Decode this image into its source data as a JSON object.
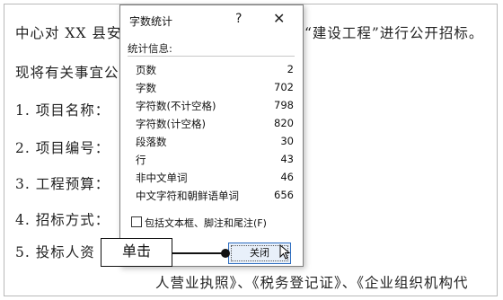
{
  "document": {
    "line1_left": "中心对 XX 县安",
    "line1_right": "“建设工程”进行公开招标。",
    "line2": "现将有关事宜公",
    "line3": "1.  项目名称：",
    "line4": "2.  项目编号：",
    "line5": "3.  工程预算：",
    "line6": "4.  招标方式：",
    "line7": "5.  投标人资",
    "line8": "人营业执照》、《税务登记证》、《企业组织机构代"
  },
  "dialog": {
    "title": "字数统计",
    "help_symbol": "?",
    "close_symbol": "✕",
    "section_label": "统计信息:",
    "stats": [
      {
        "label": "页数",
        "value": "2"
      },
      {
        "label": "字数",
        "value": "702"
      },
      {
        "label": "字符数(不计空格)",
        "value": "798"
      },
      {
        "label": "字符数(计空格)",
        "value": "820"
      },
      {
        "label": "段落数",
        "value": "30"
      },
      {
        "label": "行",
        "value": "43"
      },
      {
        "label": "非中文单词",
        "value": "46"
      },
      {
        "label": "中文字符和朝鲜语单词",
        "value": "656"
      }
    ],
    "checkbox_label": "包括文本框、脚注和尾注(F)",
    "close_button": "关闭"
  },
  "annotation": {
    "callout_text": "单击"
  }
}
